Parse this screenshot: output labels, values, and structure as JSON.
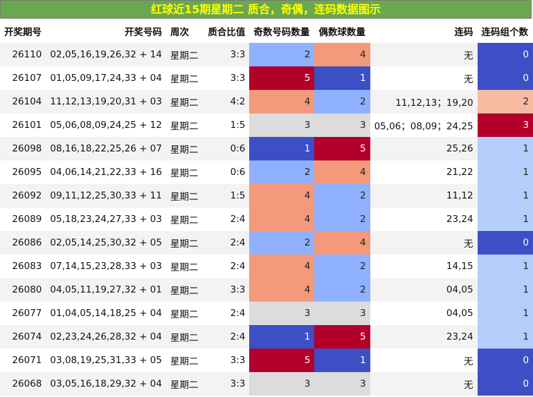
{
  "title": "红球近15期星期二 质合，奇偶，连码数据图示",
  "headers": {
    "issue": "开奖期号",
    "numbers": "开奖号码",
    "weekday": "周次",
    "ratio": "质合比值",
    "odd": "奇数号码数量",
    "even": "偶数球数量",
    "consecutive": "连码",
    "groups": "连码组个数"
  },
  "colors": {
    "dark_red": "#b2002a",
    "salmon": "#f4997a",
    "light_gray": "#dcdcdc",
    "light_blue": "#8fb1ff",
    "dark_blue": "#3c4fc4",
    "pale_blue": "#b5cdfb",
    "peach": "#f7bba1"
  },
  "rows": [
    {
      "issue": "26110",
      "numbers": "02,05,16,19,26,32 + 14",
      "weekday": "星期二",
      "ratio": "3:3",
      "odd": "2",
      "even": "4",
      "consecutive": "无",
      "groups": "0"
    },
    {
      "issue": "26107",
      "numbers": "01,05,09,17,24,33 + 04",
      "weekday": "星期二",
      "ratio": "3:3",
      "odd": "5",
      "even": "1",
      "consecutive": "无",
      "groups": "0"
    },
    {
      "issue": "26104",
      "numbers": "11,12,13,19,20,31 + 03",
      "weekday": "星期二",
      "ratio": "4:2",
      "odd": "4",
      "even": "2",
      "consecutive": "11,12,13；19,20",
      "groups": "2"
    },
    {
      "issue": "26101",
      "numbers": "05,06,08,09,24,25 + 12",
      "weekday": "星期二",
      "ratio": "1:5",
      "odd": "3",
      "even": "3",
      "consecutive": "05,06；08,09；24,25",
      "groups": "3"
    },
    {
      "issue": "26098",
      "numbers": "08,16,18,22,25,26 + 07",
      "weekday": "星期二",
      "ratio": "0:6",
      "odd": "1",
      "even": "5",
      "consecutive": "25,26",
      "groups": "1"
    },
    {
      "issue": "26095",
      "numbers": "04,06,14,21,22,33 + 16",
      "weekday": "星期二",
      "ratio": "0:6",
      "odd": "2",
      "even": "4",
      "consecutive": "21,22",
      "groups": "1"
    },
    {
      "issue": "26092",
      "numbers": "09,11,12,25,30,33 + 11",
      "weekday": "星期二",
      "ratio": "1:5",
      "odd": "4",
      "even": "2",
      "consecutive": "11,12",
      "groups": "1"
    },
    {
      "issue": "26089",
      "numbers": "05,18,23,24,27,33 + 03",
      "weekday": "星期二",
      "ratio": "2:4",
      "odd": "4",
      "even": "2",
      "consecutive": "23,24",
      "groups": "1"
    },
    {
      "issue": "26086",
      "numbers": "02,05,14,25,30,32 + 05",
      "weekday": "星期二",
      "ratio": "2:4",
      "odd": "2",
      "even": "4",
      "consecutive": "无",
      "groups": "0"
    },
    {
      "issue": "26083",
      "numbers": "07,14,15,23,28,33 + 03",
      "weekday": "星期二",
      "ratio": "2:4",
      "odd": "4",
      "even": "2",
      "consecutive": "14,15",
      "groups": "1"
    },
    {
      "issue": "26080",
      "numbers": "04,05,11,19,27,32 + 01",
      "weekday": "星期二",
      "ratio": "3:3",
      "odd": "4",
      "even": "2",
      "consecutive": "04,05",
      "groups": "1"
    },
    {
      "issue": "26077",
      "numbers": "01,04,05,14,18,25 + 04",
      "weekday": "星期二",
      "ratio": "2:4",
      "odd": "3",
      "even": "3",
      "consecutive": "04,05",
      "groups": "1"
    },
    {
      "issue": "26074",
      "numbers": "02,23,24,26,28,32 + 04",
      "weekday": "星期二",
      "ratio": "2:4",
      "odd": "1",
      "even": "5",
      "consecutive": "23,24",
      "groups": "1"
    },
    {
      "issue": "26071",
      "numbers": "03,08,19,25,31,33 + 05",
      "weekday": "星期二",
      "ratio": "3:3",
      "odd": "5",
      "even": "1",
      "consecutive": "无",
      "groups": "0"
    },
    {
      "issue": "26068",
      "numbers": "03,05,16,18,29,32 + 04",
      "weekday": "星期二",
      "ratio": "3:3",
      "odd": "3",
      "even": "3",
      "consecutive": "无",
      "groups": "0"
    }
  ]
}
